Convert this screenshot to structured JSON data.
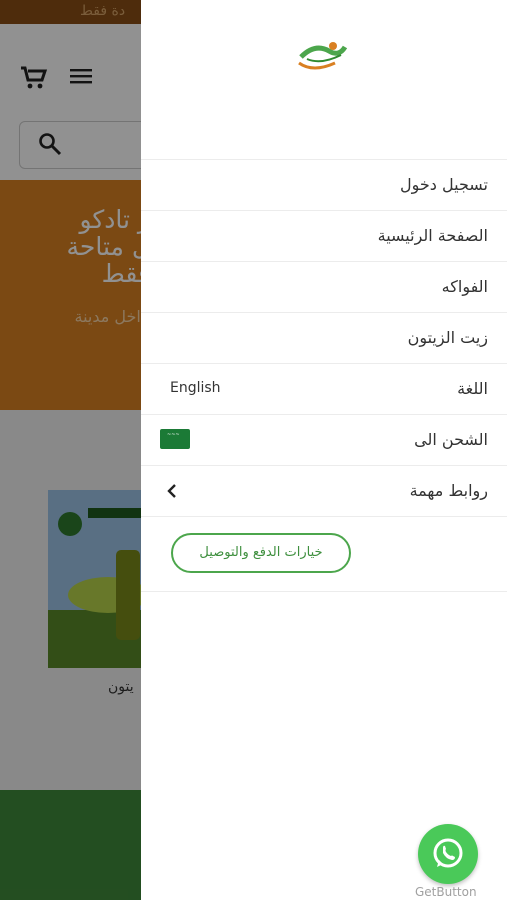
{
  "background": {
    "topbar_text": "دة فقط",
    "banner_line1": "ر تادكو\nل متاحة\nفقط",
    "banner_line2": "داخل مدينة",
    "product_name": "يتون"
  },
  "drawer": {
    "items": [
      {
        "label": "تسجيل دخول"
      },
      {
        "label": "الصفحة الرئيسية"
      },
      {
        "label": "الفواكه"
      },
      {
        "label": "زيت الزيتون"
      },
      {
        "label": "اللغة",
        "value": "English"
      },
      {
        "label": "الشحن الى"
      },
      {
        "label": "روابط مهمة"
      }
    ],
    "payment_button": "خيارات الدفع والتوصيل"
  },
  "whatsapp": {
    "caption": "GetButton"
  },
  "colors": {
    "accent_green": "#4ca64c",
    "banner_orange": "#d98022",
    "footer_green": "#3f8a3a",
    "whatsapp_green": "#4ac959"
  }
}
